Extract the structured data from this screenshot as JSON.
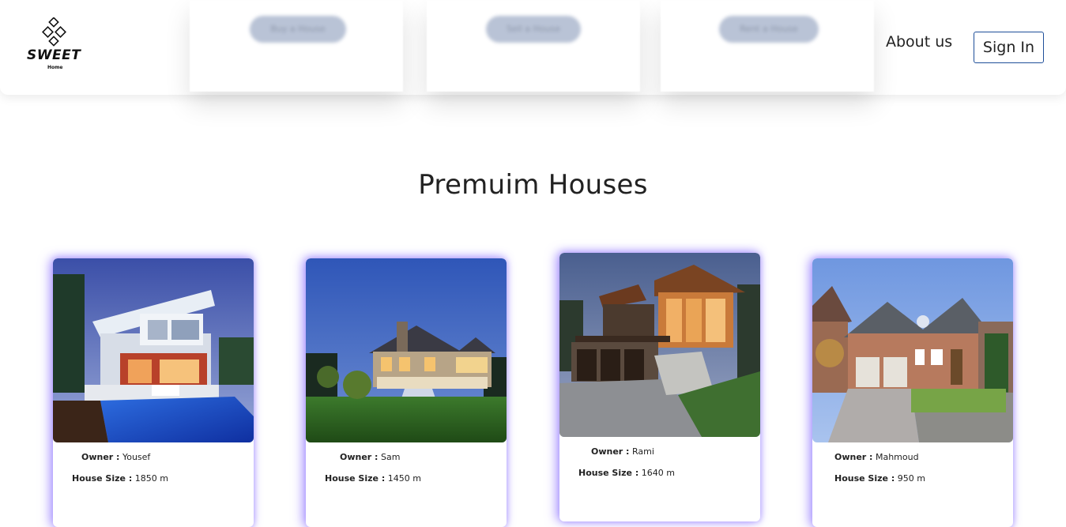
{
  "brand": {
    "name": "SWEET",
    "sub": "Home"
  },
  "nav": {
    "pills": [
      "Buy a House",
      "Sell a House",
      "Rent a House"
    ],
    "about": "About us",
    "signin": "Sign In"
  },
  "section": {
    "title": "Premuim Houses"
  },
  "labels": {
    "owner": "Owner :",
    "size": "House Size :"
  },
  "houses": [
    {
      "owner": "Yousef",
      "size": "1850 m"
    },
    {
      "owner": "Sam",
      "size": "1450 m"
    },
    {
      "owner": "Rami",
      "size": "1640 m"
    },
    {
      "owner": "Mahmoud",
      "size": "950 m"
    }
  ],
  "colors": {
    "accent": "#7c5dff",
    "signin_border": "#1f4f99"
  }
}
